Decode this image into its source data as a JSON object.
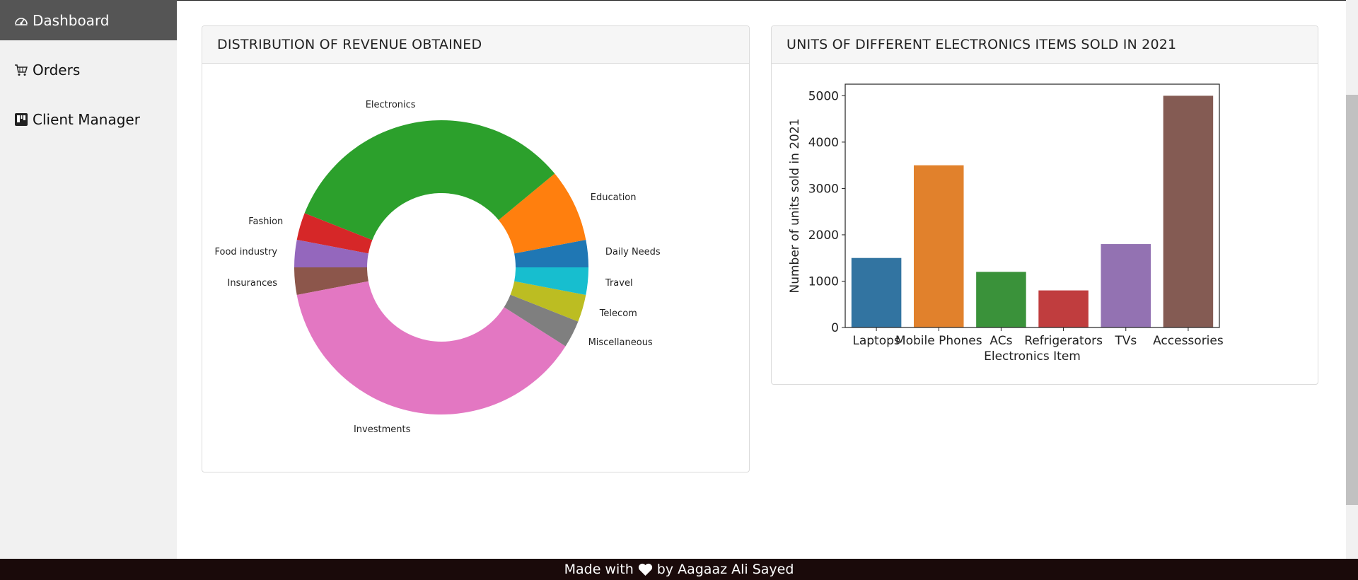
{
  "sidebar": {
    "items": [
      {
        "label": "Dashboard",
        "icon": "speedometer-icon",
        "active": true
      },
      {
        "label": "Orders",
        "icon": "cart-icon",
        "active": false
      },
      {
        "label": "Client Manager",
        "icon": "kanban-icon",
        "active": false
      }
    ]
  },
  "cards": {
    "pie_title": "DISTRIBUTION OF REVENUE OBTAINED",
    "bar_title": "UNITS OF DIFFERENT ELECTRONICS ITEMS SOLD IN 2021"
  },
  "footer": {
    "text_before": "Made with",
    "icon": "heart-icon",
    "text_after": "by Aagaaz Ali Sayed"
  },
  "chart_data": [
    {
      "type": "pie",
      "style": "donut",
      "title": "",
      "labels": [
        "Daily Needs",
        "Education",
        "Electronics",
        "Fashion",
        "Food industry",
        "Insurances",
        "Investments",
        "Miscellaneous",
        "Telecom",
        "Travel"
      ],
      "values": [
        3,
        8,
        33,
        3,
        3,
        3,
        38,
        3,
        3,
        3
      ],
      "colors": [
        "#1f77b4",
        "#ff7f0e",
        "#2ca02c",
        "#d62728",
        "#9467bd",
        "#8c564b",
        "#e377c2",
        "#7f7f7f",
        "#bcbd22",
        "#17becf"
      ]
    },
    {
      "type": "bar",
      "title": "",
      "categories": [
        "Laptops",
        "Mobile Phones",
        "ACs",
        "Refrigerators",
        "TVs",
        "Accessories"
      ],
      "values": [
        1500,
        3500,
        1200,
        800,
        1800,
        5000
      ],
      "colors": [
        "#3274a1",
        "#e1812c",
        "#3a923a",
        "#c03d3e",
        "#9372b2",
        "#845b53"
      ],
      "xlabel": "Electronics Item",
      "ylabel": "Number of units sold in 2021",
      "ylim": [
        0,
        5250
      ],
      "yticks": [
        0,
        1000,
        2000,
        3000,
        4000,
        5000
      ],
      "grid": false
    }
  ]
}
